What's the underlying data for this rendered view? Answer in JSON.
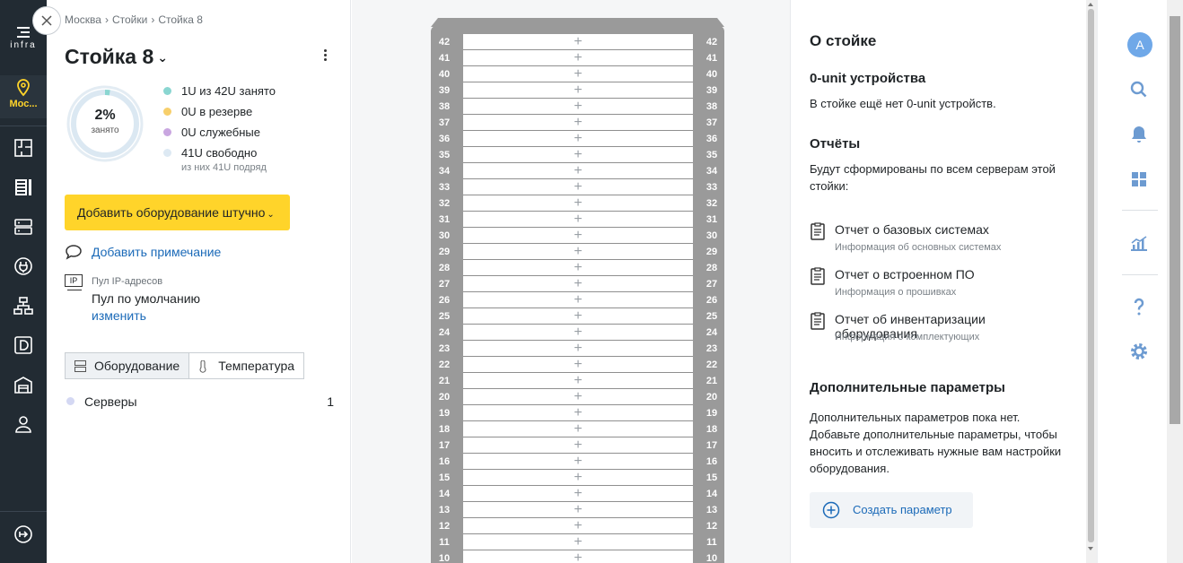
{
  "nav": {
    "logo_text": "infra",
    "location_label": "Мос..."
  },
  "breadcrumbs": [
    "Москва",
    "Стойки",
    "Стойка 8"
  ],
  "rack": {
    "title": "Стойка 8",
    "usage_percent": "2%",
    "usage_label": "занято",
    "usage_fraction": 0.024,
    "legend": [
      {
        "text": "1U из 42U занято",
        "color": "#8ad6d1"
      },
      {
        "text": "0U в резерве",
        "color": "#f7cf6b"
      },
      {
        "text": "0U служебные",
        "color": "#c9a6e0"
      },
      {
        "text": "41U свободно",
        "color": "#dde9f3"
      }
    ],
    "free_note": "из них 41U подряд",
    "add_button": "Добавить оборудование штучно",
    "add_note": "Добавить примечание",
    "ip_pool_label": "Пул IP-адресов",
    "ip_pool_value": "Пул по умолчанию",
    "ip_pool_change": "изменить",
    "ip_icon_text": "IP",
    "tabs": [
      "Оборудование",
      "Температура"
    ],
    "categories": [
      {
        "name": "Серверы",
        "count": "1"
      }
    ],
    "units": [
      "42",
      "41",
      "40",
      "39",
      "38",
      "37",
      "36",
      "35",
      "34",
      "33",
      "32",
      "31",
      "30",
      "29",
      "28",
      "27",
      "26",
      "25",
      "24",
      "23",
      "22",
      "21",
      "20",
      "19",
      "18",
      "17",
      "16",
      "15",
      "14",
      "13",
      "12",
      "11",
      "10"
    ]
  },
  "about": {
    "title": "О стойке",
    "zero_unit_title": "0-unit устройства",
    "zero_unit_text": "В стойке ещё нет 0-unit устройств.",
    "reports_title": "Отчёты",
    "reports_text": "Будут сформированы по всем серверам этой стойки:",
    "reports": [
      {
        "title": "Отчет о базовых системах",
        "sub": "Информация об основных системах"
      },
      {
        "title": "Отчет о встроенном ПО",
        "sub": "Информация о прошивках"
      },
      {
        "title": "Отчет об инвентаризации оборудования",
        "sub": "Информация о комплектующих"
      }
    ],
    "params_title": "Дополнительные параметры",
    "params_text": "Дополнительных параметров пока нет. Добавьте дополнительные параметры, чтобы вносить и отслеживать нужные вам настройки оборудования.",
    "create_param": "Создать параметр"
  },
  "sidebar": {
    "avatar_letter": "A"
  },
  "colors": {
    "nav_bg": "#222b33",
    "accent_yellow": "#ffd42a",
    "link_blue": "#1b6ab8",
    "rack_gray": "#9a9a9a"
  }
}
